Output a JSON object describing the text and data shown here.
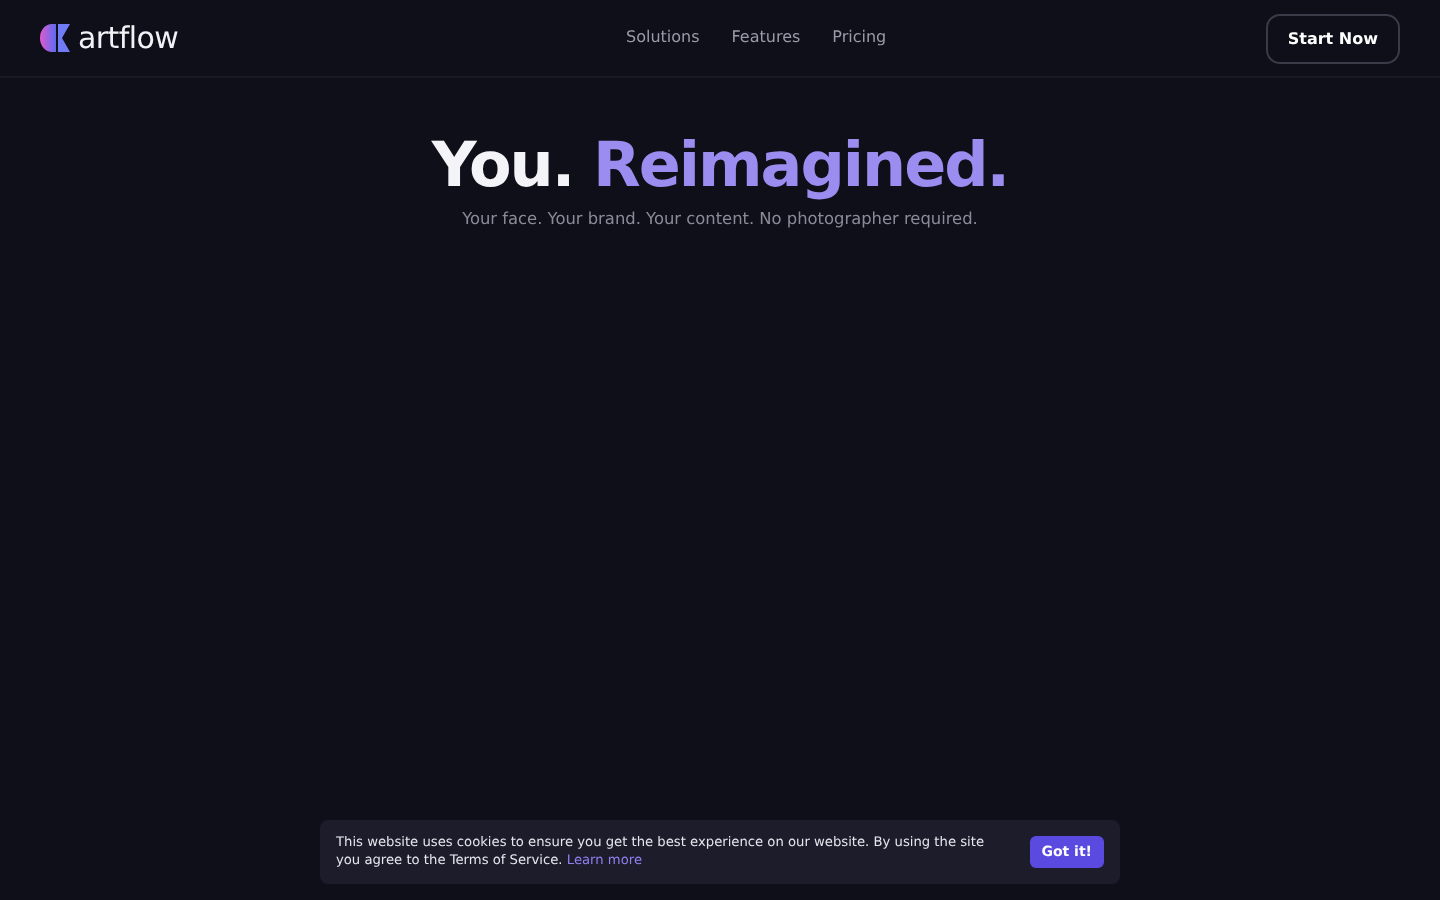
{
  "header": {
    "logo_text": "artflow",
    "nav": [
      "Solutions",
      "Features",
      "Pricing"
    ],
    "cta": "Start Now"
  },
  "hero": {
    "title_lead": "You.",
    "title_accent": "Reimagined.",
    "subtitle": "Your face. Your brand. Your content. No photographer required."
  },
  "cookie_banner": {
    "text": "This website uses cookies to ensure you get the best experience on our website. By using the site you agree to the Terms of Service.",
    "link": "Learn more",
    "button": "Got it!"
  }
}
